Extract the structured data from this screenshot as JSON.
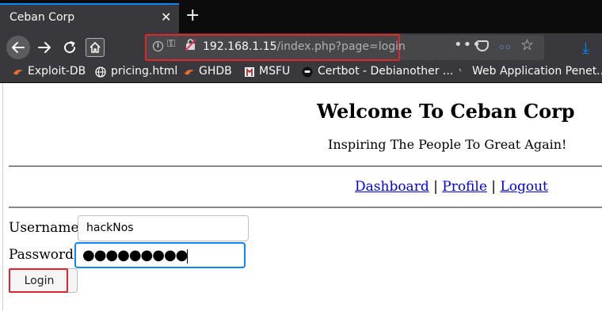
{
  "tab": {
    "title": "Ceban Corp",
    "close_glyph": "✕",
    "new_tab_glyph": "+"
  },
  "navbar": {
    "url_host": "192.168.1.15",
    "url_path": "/index.php?page=login",
    "more_glyph": "•••",
    "star_glyph": "☆",
    "download_glyph": "⤓",
    "ext_label": "ㅇㅇ"
  },
  "bookmarks": [
    {
      "label": "Exploit-DB",
      "icon": "exploit-db-icon"
    },
    {
      "label": "pricing.html",
      "icon": "globe-icon"
    },
    {
      "label": "GHDB",
      "icon": "exploit-db-icon"
    },
    {
      "label": "MSFU",
      "icon": "metasploit-icon"
    },
    {
      "label": "Certbot - Debianother ...",
      "icon": "certbot-icon"
    },
    {
      "label": "Web Application Penet...",
      "icon": "page-icon"
    }
  ],
  "page": {
    "heading": "Welcome To Ceban Corp",
    "tagline": "Inspiring The People To Great Again!",
    "nav": {
      "dashboard": "Dashboard",
      "profile": "Profile",
      "logout": "Logout",
      "separator": "|"
    },
    "username_label": "Username",
    "username_value": "hackNos",
    "password_label": "Password",
    "password_mask": "●●●●●●●●●",
    "login_label": "Login"
  },
  "colors": {
    "highlight": "#e2252b",
    "focus": "#0a84ff",
    "link": "#0000ee",
    "chrome": "#38383d"
  }
}
